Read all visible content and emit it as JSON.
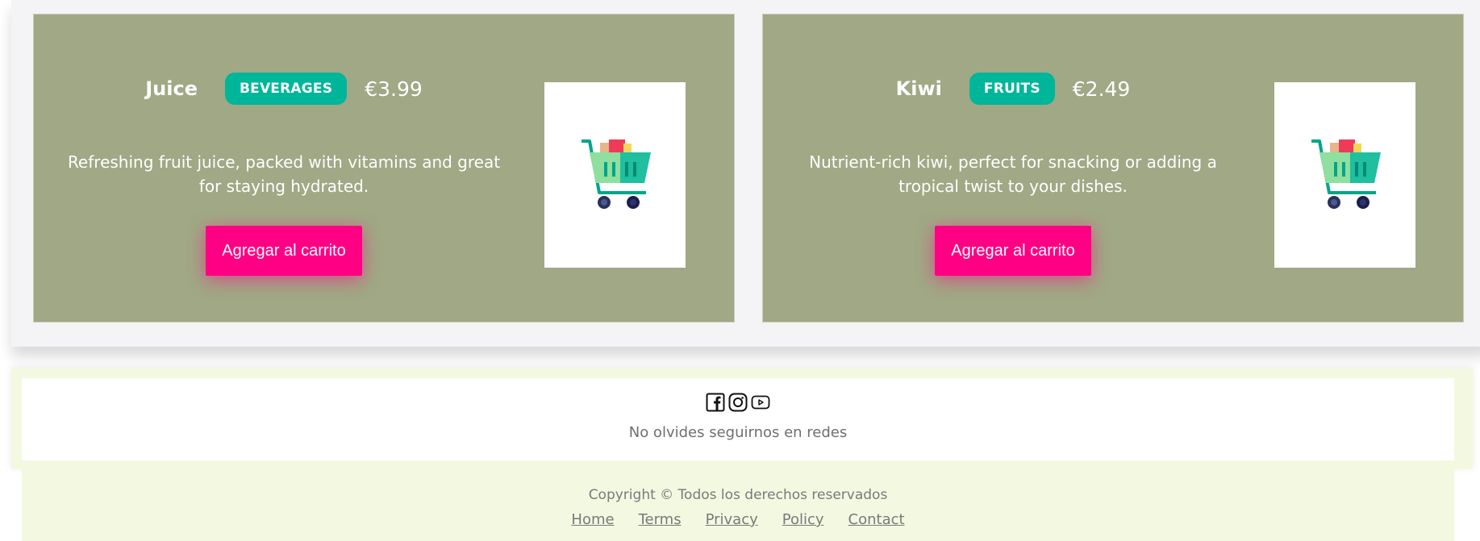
{
  "products": [
    {
      "name": "Juice",
      "category": "BEVERAGES",
      "price": "€3.99",
      "description": "Refreshing fruit juice, packed with vitamins and great for staying hydrated.",
      "button_label": "Agregar al carrito",
      "image_icon": "shopping-cart-icon"
    },
    {
      "name": "Kiwi",
      "category": "FRUITS",
      "price": "€2.49",
      "description": "Nutrient-rich kiwi, perfect for snacking or adding a tropical twist to your dishes.",
      "button_label": "Agregar al carrito",
      "image_icon": "shopping-cart-icon"
    }
  ],
  "social": {
    "icons": [
      "facebook-icon",
      "instagram-icon",
      "youtube-icon"
    ],
    "text": "No olvides seguirnos en redes"
  },
  "footer": {
    "copyright": "Copyright © Todos los derechos reservados",
    "links": [
      "Home",
      "Terms",
      "Privacy",
      "Policy",
      "Contact"
    ]
  },
  "colors": {
    "card_bg": "#a0a885",
    "badge": "#00b69a",
    "button": "#ff0084",
    "footer_bg": "#f3f8e1"
  }
}
